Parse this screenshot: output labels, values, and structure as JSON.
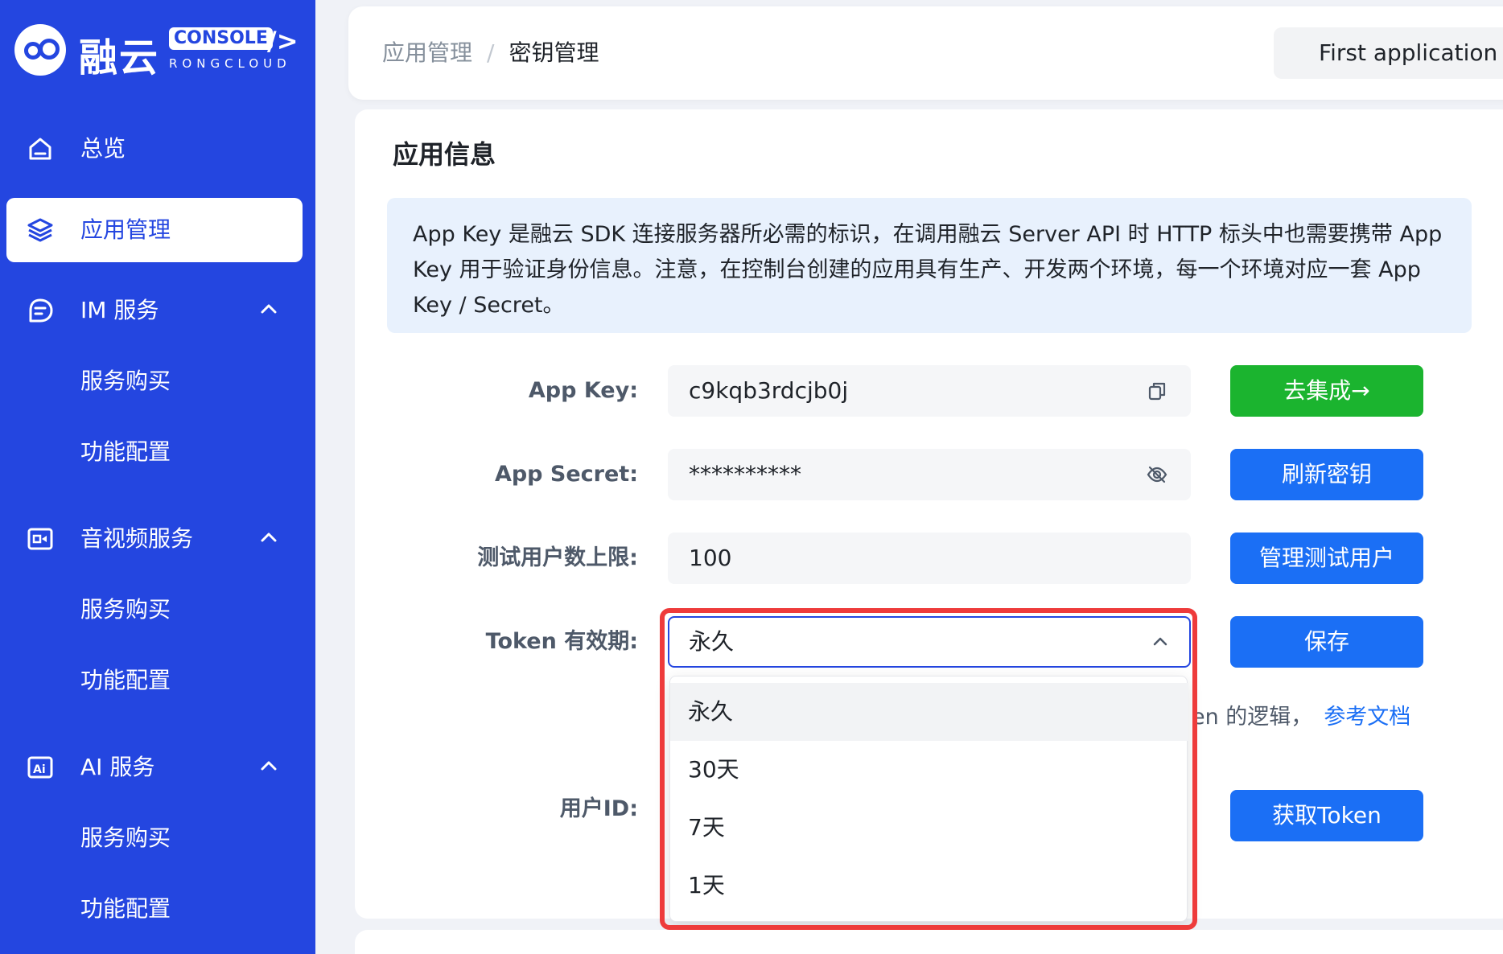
{
  "sidebar": {
    "logo": {
      "name": "融云",
      "console": "CONSOLE",
      "sub": "RONGCLOUD"
    },
    "items": [
      {
        "label": "总览",
        "icon": "home-icon"
      },
      {
        "label": "应用管理",
        "icon": "layers-icon",
        "active": true
      },
      {
        "label": "IM 服务",
        "icon": "chat-icon",
        "expanded": true,
        "children": [
          "服务购买",
          "功能配置"
        ]
      },
      {
        "label": "音视频服务",
        "icon": "video-icon",
        "expanded": true,
        "children": [
          "服务购买",
          "功能配置"
        ]
      },
      {
        "label": "AI 服务",
        "icon": "ai-icon",
        "expanded": true,
        "children": [
          "服务购买",
          "功能配置"
        ]
      }
    ]
  },
  "header": {
    "breadcrumb": [
      "应用管理",
      "密钥管理"
    ],
    "breadcrumb_separator": "/",
    "app_selector": "First application"
  },
  "card": {
    "title": "应用信息",
    "notice": "App Key 是融云 SDK 连接服务器所必需的标识，在调用融云 Server API 时 HTTP 标头中也需要携带 App Key 用于验证身份信息。注意，在控制台创建的应用具有生产、开发两个环境，每一个环境对应一套 App Key / Secret。",
    "app_key": {
      "label": "App Key:",
      "value": "c9kqb3rdcjb0j",
      "button": "去集成→"
    },
    "app_secret": {
      "label": "App Secret:",
      "value": "**********",
      "button": "刷新密钥"
    },
    "test_users": {
      "label": "测试用户数上限:",
      "value": "100",
      "button": "管理测试用户"
    },
    "token_validity": {
      "label": "Token 有效期:",
      "value": "永久",
      "button": "保存"
    },
    "hint": {
      "text": "en 的逻辑，",
      "link": "参考文档"
    },
    "user_id": {
      "label": "用户ID:",
      "button": "获取Token"
    }
  },
  "dropdown": {
    "options": [
      "永久",
      "30天",
      "7天",
      "1天"
    ],
    "selected": "永久"
  },
  "colors": {
    "sidebar": "#2446e0",
    "primary": "#1b6ff5",
    "success": "#1bb42f",
    "highlight": "#ee3b3b"
  }
}
